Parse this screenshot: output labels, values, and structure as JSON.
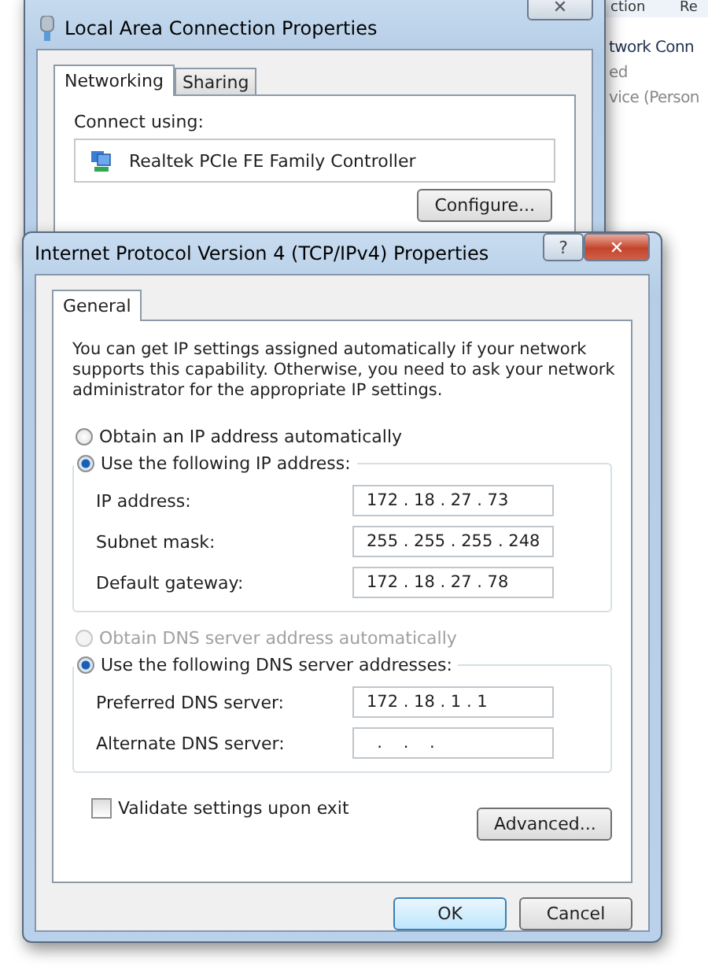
{
  "background_window": {
    "header": [
      "ction",
      "Re"
    ],
    "lines": [
      "twork Conn",
      "ed",
      "vice (Person"
    ]
  },
  "back_dialog": {
    "title": "Local Area Connection Properties",
    "close": "✕",
    "tabs": [
      {
        "label": "Networking",
        "selected": true
      },
      {
        "label": "Sharing",
        "selected": false
      }
    ],
    "connect_label": "Connect using:",
    "adapter": "Realtek PCIe FE Family Controller",
    "configure_button": "Configure..."
  },
  "dialog": {
    "title": "Internet Protocol Version 4 (TCP/IPv4) Properties",
    "help": "?",
    "close": "✕",
    "tabs": [
      {
        "label": "General",
        "selected": true
      }
    ],
    "description": "You can get IP settings assigned automatically if your network supports this capability. Otherwise, you need to ask your network administrator for the appropriate IP settings.",
    "sections": [
      {
        "auto_option": {
          "label": "Obtain an IP address automatically",
          "selected": false,
          "disabled": false
        },
        "manual_option": {
          "label": "Use the following IP address:",
          "selected": true,
          "disabled": false
        },
        "fields": [
          {
            "label": "IP address:",
            "value": "172 . 18 . 27 . 73"
          },
          {
            "label": "Subnet mask:",
            "value": "255 . 255 . 255 . 248"
          },
          {
            "label": "Default gateway:",
            "value": "172 . 18 . 27 . 78"
          }
        ]
      },
      {
        "auto_option": {
          "label": "Obtain DNS server address automatically",
          "selected": false,
          "disabled": true
        },
        "manual_option": {
          "label": "Use the following DNS server addresses:",
          "selected": true,
          "disabled": false
        },
        "fields": [
          {
            "label": "Preferred DNS server:",
            "value": "172 . 18 . 1 . 1"
          },
          {
            "label": "Alternate DNS server:",
            "value": "  .    .    ."
          }
        ]
      }
    ],
    "validate": {
      "label": "Validate settings upon exit",
      "checked": false
    },
    "advanced_button": "Advanced...",
    "buttons": [
      {
        "label": "OK",
        "kind": "default"
      },
      {
        "label": "Cancel",
        "kind": "normal"
      }
    ]
  }
}
